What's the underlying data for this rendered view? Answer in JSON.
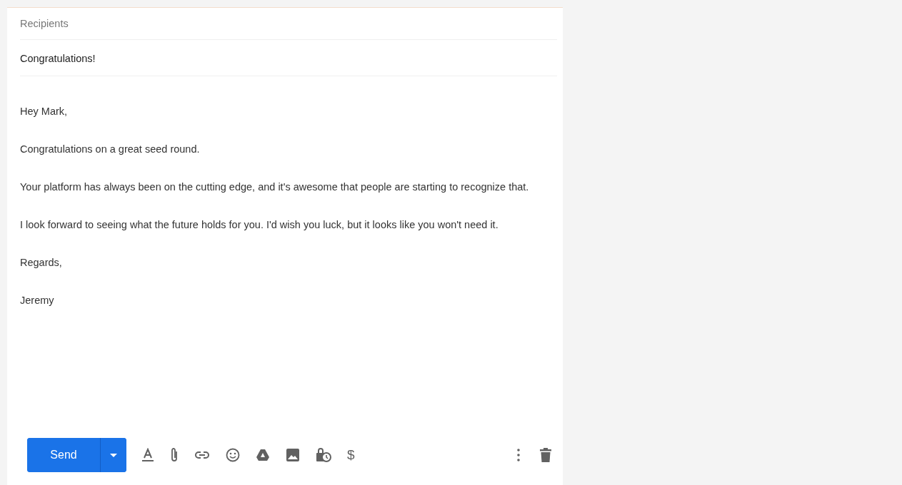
{
  "recipients": {
    "placeholder": "Recipients"
  },
  "subject": {
    "value": "Congratulations!"
  },
  "body": {
    "paragraphs": [
      "Hey Mark,",
      "Congratulations on a great seed round.",
      "Your platform has always been on the cutting edge, and it's awesome that people are starting to recognize that.",
      "I look forward to seeing what the future holds for you. I'd wish you luck, but it looks like you won't need it.",
      "Regards,",
      "Jeremy"
    ]
  },
  "toolbar": {
    "send_label": "Send",
    "money_glyph": "$"
  }
}
